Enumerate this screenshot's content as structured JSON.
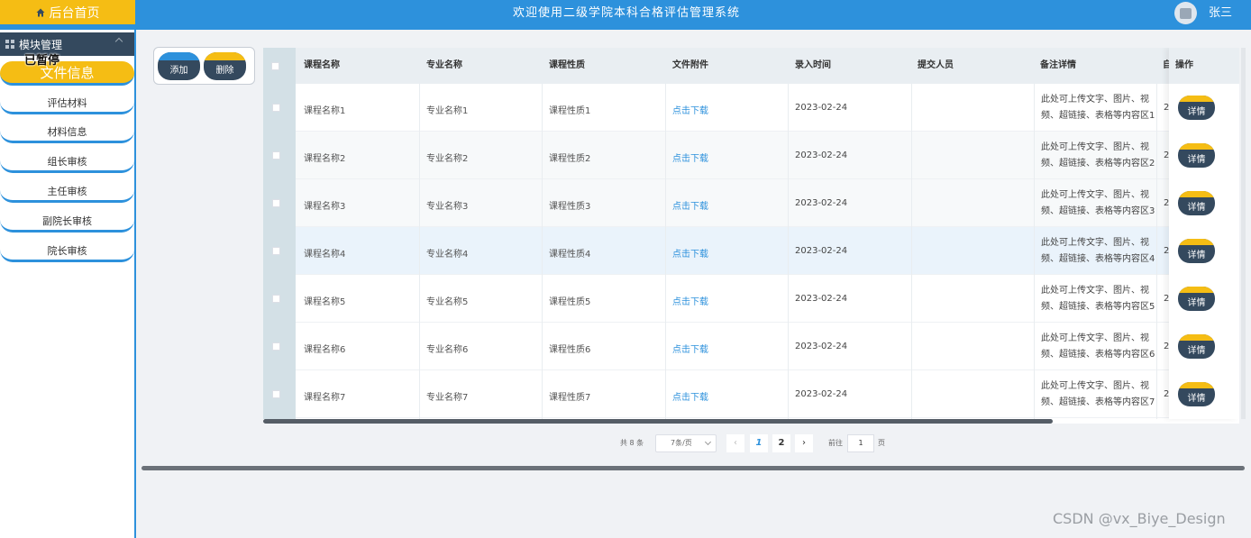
{
  "header": {
    "home_label": "后台首页",
    "system_title": "欢迎使用二级学院本科合格评估管理系统",
    "username": "张三",
    "icons": [
      "home-icon",
      "avatar-image-icon"
    ]
  },
  "sidebar": {
    "module_label": "模块管理",
    "pause_label": "已暂停",
    "active_item": "文件信息",
    "items": [
      {
        "label": "评估材料"
      },
      {
        "label": "材料信息"
      },
      {
        "label": "组长审核"
      },
      {
        "label": "主任审核"
      },
      {
        "label": "副院长审核"
      },
      {
        "label": "院长审核"
      }
    ]
  },
  "toolbar": {
    "add_label": "添加",
    "delete_label": "删除"
  },
  "table": {
    "columns": [
      "课程名称",
      "专业名称",
      "课程性质",
      "文件附件",
      "录入时间",
      "提交人员",
      "备注详情",
      "操作"
    ],
    "truncated_col_mark": "自",
    "truncated_cell_mark": "2",
    "rows": [
      {
        "course": "课程名称1",
        "major": "专业名称1",
        "nature": "课程性质1",
        "attachment": "点击下载",
        "date": "2023-02-24",
        "submitter": "",
        "note": "此处可上传文字、图片、视频、超链接、表格等内容区1",
        "action": "详情"
      },
      {
        "course": "课程名称2",
        "major": "专业名称2",
        "nature": "课程性质2",
        "attachment": "点击下载",
        "date": "2023-02-24",
        "submitter": "",
        "note": "此处可上传文字、图片、视频、超链接、表格等内容区2",
        "action": "详情"
      },
      {
        "course": "课程名称3",
        "major": "专业名称3",
        "nature": "课程性质3",
        "attachment": "点击下载",
        "date": "2023-02-24",
        "submitter": "",
        "note": "此处可上传文字、图片、视频、超链接、表格等内容区3",
        "action": "详情"
      },
      {
        "course": "课程名称4",
        "major": "专业名称4",
        "nature": "课程性质4",
        "attachment": "点击下载",
        "date": "2023-02-24",
        "submitter": "",
        "note": "此处可上传文字、图片、视频、超链接、表格等内容区4",
        "action": "详情"
      },
      {
        "course": "课程名称5",
        "major": "专业名称5",
        "nature": "课程性质5",
        "attachment": "点击下载",
        "date": "2023-02-24",
        "submitter": "",
        "note": "此处可上传文字、图片、视频、超链接、表格等内容区5",
        "action": "详情"
      },
      {
        "course": "课程名称6",
        "major": "专业名称6",
        "nature": "课程性质6",
        "attachment": "点击下载",
        "date": "2023-02-24",
        "submitter": "",
        "note": "此处可上传文字、图片、视频、超链接、表格等内容区6",
        "action": "详情"
      },
      {
        "course": "课程名称7",
        "major": "专业名称7",
        "nature": "课程性质7",
        "attachment": "点击下载",
        "date": "2023-02-24",
        "submitter": "",
        "note": "此处可上传文字、图片、视频、超链接、表格等内容区7",
        "action": "详情"
      }
    ]
  },
  "pagination": {
    "total": "共 8 条",
    "page_size": "7条/页",
    "prev": "‹",
    "pages": [
      "1",
      "2"
    ],
    "current_page": "1",
    "next": "›",
    "goto_label": "前往",
    "goto_value": "1",
    "goto_unit": "页"
  },
  "watermark": "CSDN @vx_Biye_Design",
  "colors": {
    "primary": "#2d91dc",
    "accent": "#f5bd14",
    "dark": "#34495e"
  }
}
